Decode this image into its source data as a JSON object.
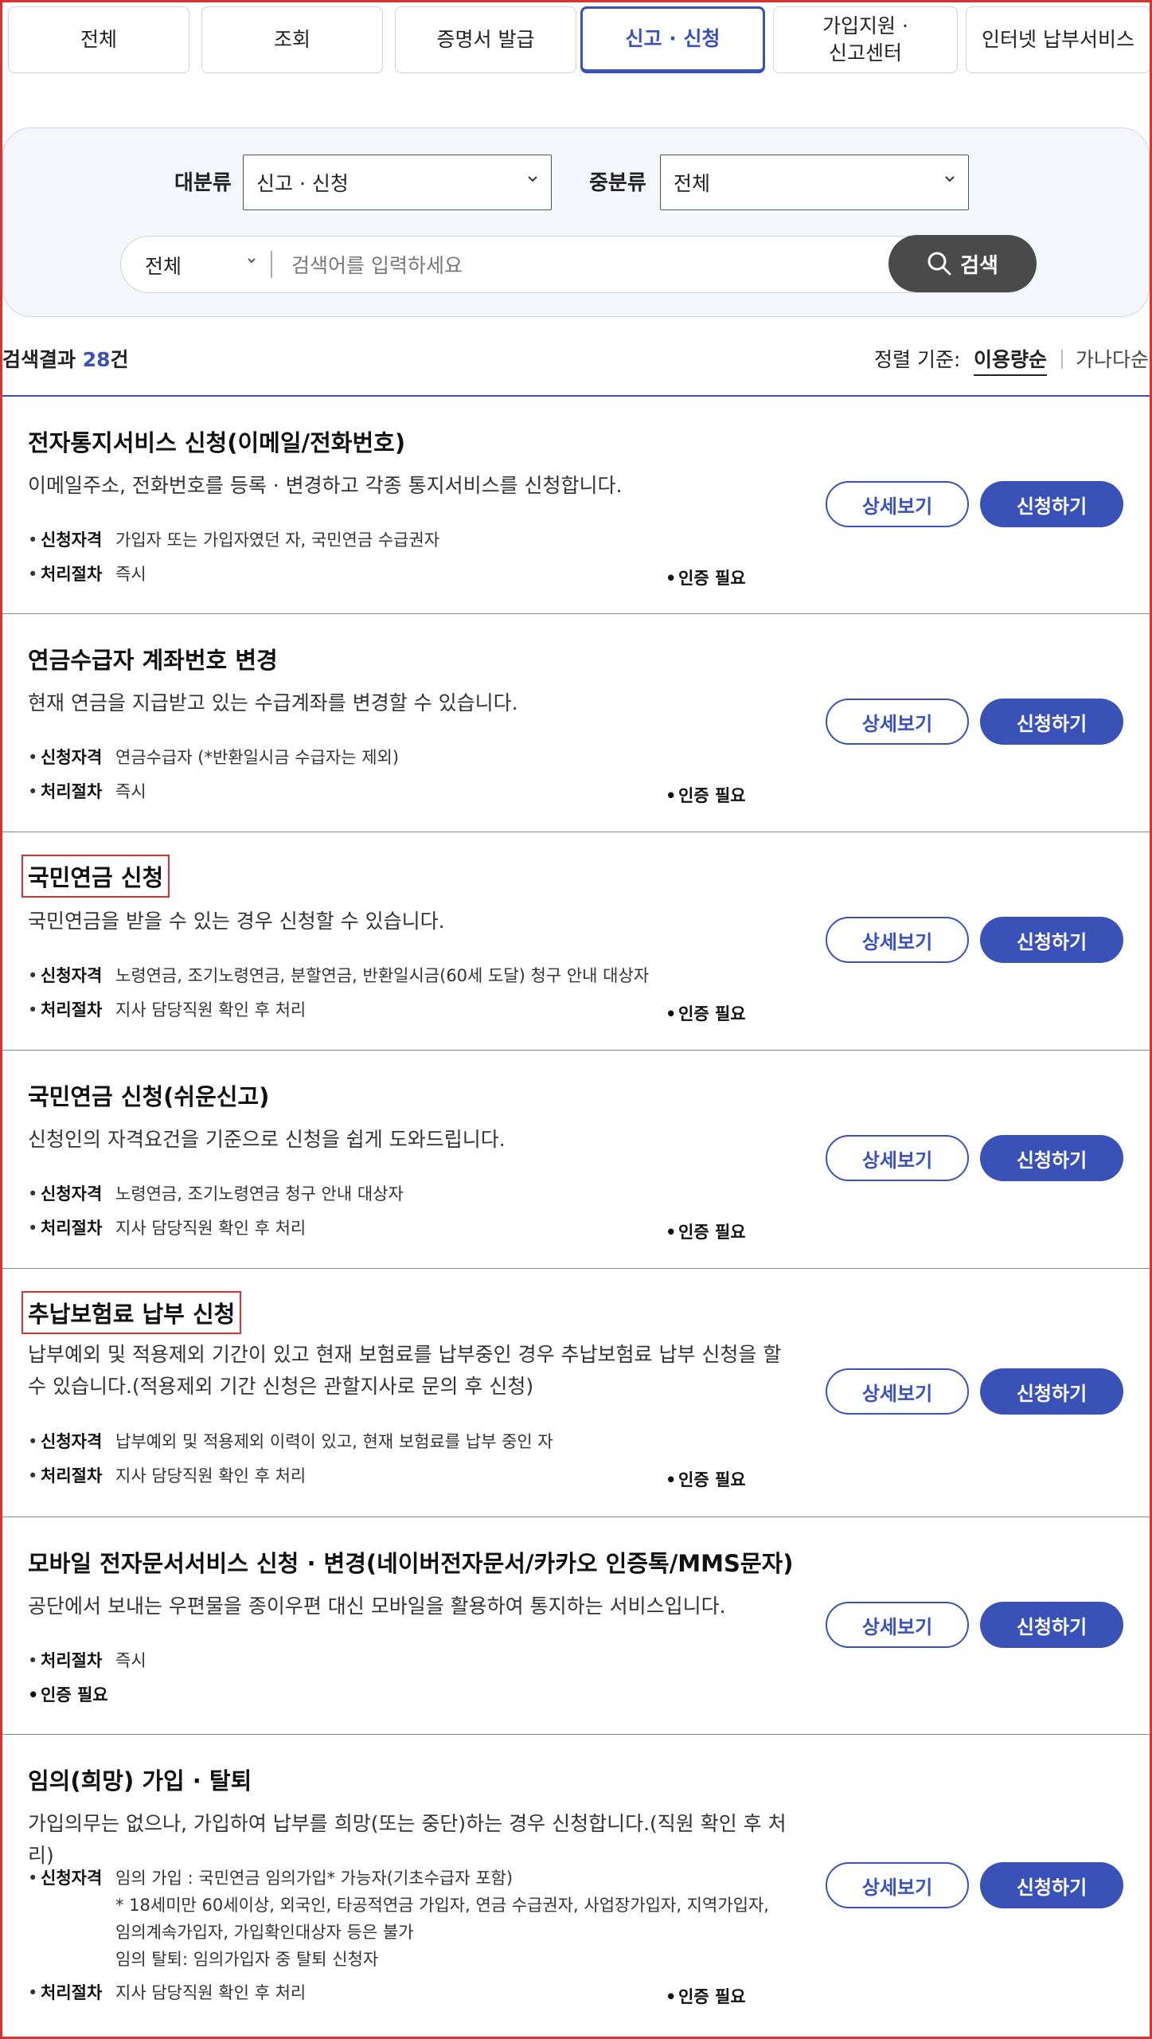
{
  "tabs": [
    {
      "label": "전체"
    },
    {
      "label": "조회"
    },
    {
      "label": "증명서 발급"
    },
    {
      "label": "신고 · 신청"
    },
    {
      "label": "가입지원 ·\n신고센터"
    },
    {
      "label": "인터넷 납부서비스"
    }
  ],
  "active_tab_index": 3,
  "filter": {
    "major_label": "대분류",
    "major_value": "신고 · 신청",
    "minor_label": "중분류",
    "minor_value": "전체",
    "scope_value": "전체",
    "search_placeholder": "검색어를 입력하세요",
    "search_button": "검색"
  },
  "results": {
    "prefix": "검색결과",
    "count": "28",
    "suffix": "건",
    "sort_label": "정렬 기준:",
    "sort_options": [
      "이용량순",
      "가나다순"
    ]
  },
  "labels": {
    "eligibility": "신청자격",
    "procedure": "처리절차",
    "auth_required": "인증 필요",
    "detail_button": "상세보기",
    "apply_button": "신청하기"
  },
  "items": [
    {
      "title": "전자통지서비스 신청(이메일/전화번호)",
      "desc": "이메일주소, 전화번호를 등록 · 변경하고 각종 통지서비스를 신청합니다.",
      "eligibility": "가입자 또는 가입자였던 자, 국민연금 수급권자",
      "procedure": "즉시"
    },
    {
      "title": "연금수급자 계좌번호 변경",
      "desc": "현재 연금을 지급받고 있는 수급계좌를 변경할 수 있습니다.",
      "eligibility": "연금수급자 (*반환일시금 수급자는 제외)",
      "procedure": "즉시"
    },
    {
      "title": "국민연금 신청",
      "desc": "국민연금을 받을 수 있는 경우 신청할 수 있습니다.",
      "eligibility": "노령연금, 조기노령연금, 분할연금, 반환일시금(60세 도달) 청구 안내 대상자",
      "procedure": "지사 담당직원 확인 후 처리"
    },
    {
      "title": "국민연금 신청(쉬운신고)",
      "desc": "신청인의 자격요건을 기준으로 신청을 쉽게 도와드립니다.",
      "eligibility": "노령연금, 조기노령연금 청구 안내 대상자",
      "procedure": "지사 담당직원 확인 후 처리"
    },
    {
      "title": "추납보험료 납부 신청",
      "desc": "납부예외 및 적용제외 기간이 있고 현재 보험료를 납부중인 경우 추납보험료 납부 신청을 할 수 있습니다.(적용제외 기간 신청은 관할지사로 문의 후 신청)",
      "eligibility": "납부예외 및 적용제외 이력이 있고, 현재 보험료를 납부 중인 자",
      "procedure": "지사 담당직원 확인 후 처리"
    },
    {
      "title": "모바일 전자문서서비스 신청 · 변경(네이버전자문서/카카오 인증톡/MMS문자)",
      "desc": "공단에서 보내는 우편물을 종이우편 대신 모바일을 활용하여 통지하는 서비스입니다.",
      "procedure": "즉시"
    },
    {
      "title": "임의(희망) 가입 · 탈퇴",
      "desc": "가입의무는 없으나, 가입하여 납부를 희망(또는 중단)하는 경우 신청합니다.(직원 확인 후 처리)",
      "eligibility": "임의 가입 : 국민연금 임의가입* 가능자(기초수급자 포함)\n* 18세미만 60세이상, 외국인, 타공적연금 가입자, 연금 수급권자, 사업장가입자, 지역가입자,\n임의계속가입자, 가입확인대상자 등은 불가\n임의 탈퇴: 임의가입자 중 탈퇴 신청자",
      "procedure": "지사 담당직원 확인 후 처리"
    }
  ],
  "colors": {
    "accent": "#3a52b8",
    "highlight_border": "#e0302e",
    "search_button": "#4a4a4a",
    "panel_bg": "#f4f6fb"
  }
}
